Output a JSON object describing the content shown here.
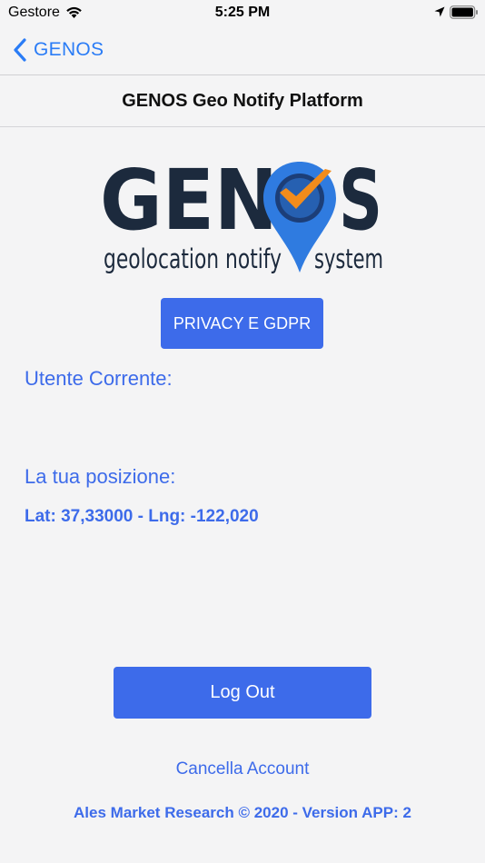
{
  "status_bar": {
    "carrier": "Gestore",
    "time": "5:25 PM",
    "icons": [
      "wifi-icon",
      "location-arrow-icon",
      "battery-icon"
    ]
  },
  "nav": {
    "back_label": "GENOS",
    "back_icon": "chevron-left-icon"
  },
  "page": {
    "title": "GENOS Geo Notify Platform"
  },
  "logo": {
    "word_left": "GEN",
    "word_right": "S",
    "tagline_left": "geolocation notify",
    "tagline_right": "system",
    "colors": {
      "dark": "#1c2a3d",
      "pin": "#2f7be0",
      "check": "#f28c1c"
    }
  },
  "buttons": {
    "privacy_label": "PRIVACY E GDPR",
    "logout_label": "Log Out",
    "delete_account_label": "Cancella Account"
  },
  "user": {
    "current_user_label": "Utente Corrente:",
    "position_label": "La tua posizione:",
    "coordinates": "Lat: 37,33000 - Lng: -122,020"
  },
  "footer": {
    "text": "Ales Market Research © 2020 - Version APP: 2"
  },
  "colors": {
    "accent": "#3d6bea",
    "ios_blue": "#2a7cf6",
    "background": "#f4f4f5"
  }
}
